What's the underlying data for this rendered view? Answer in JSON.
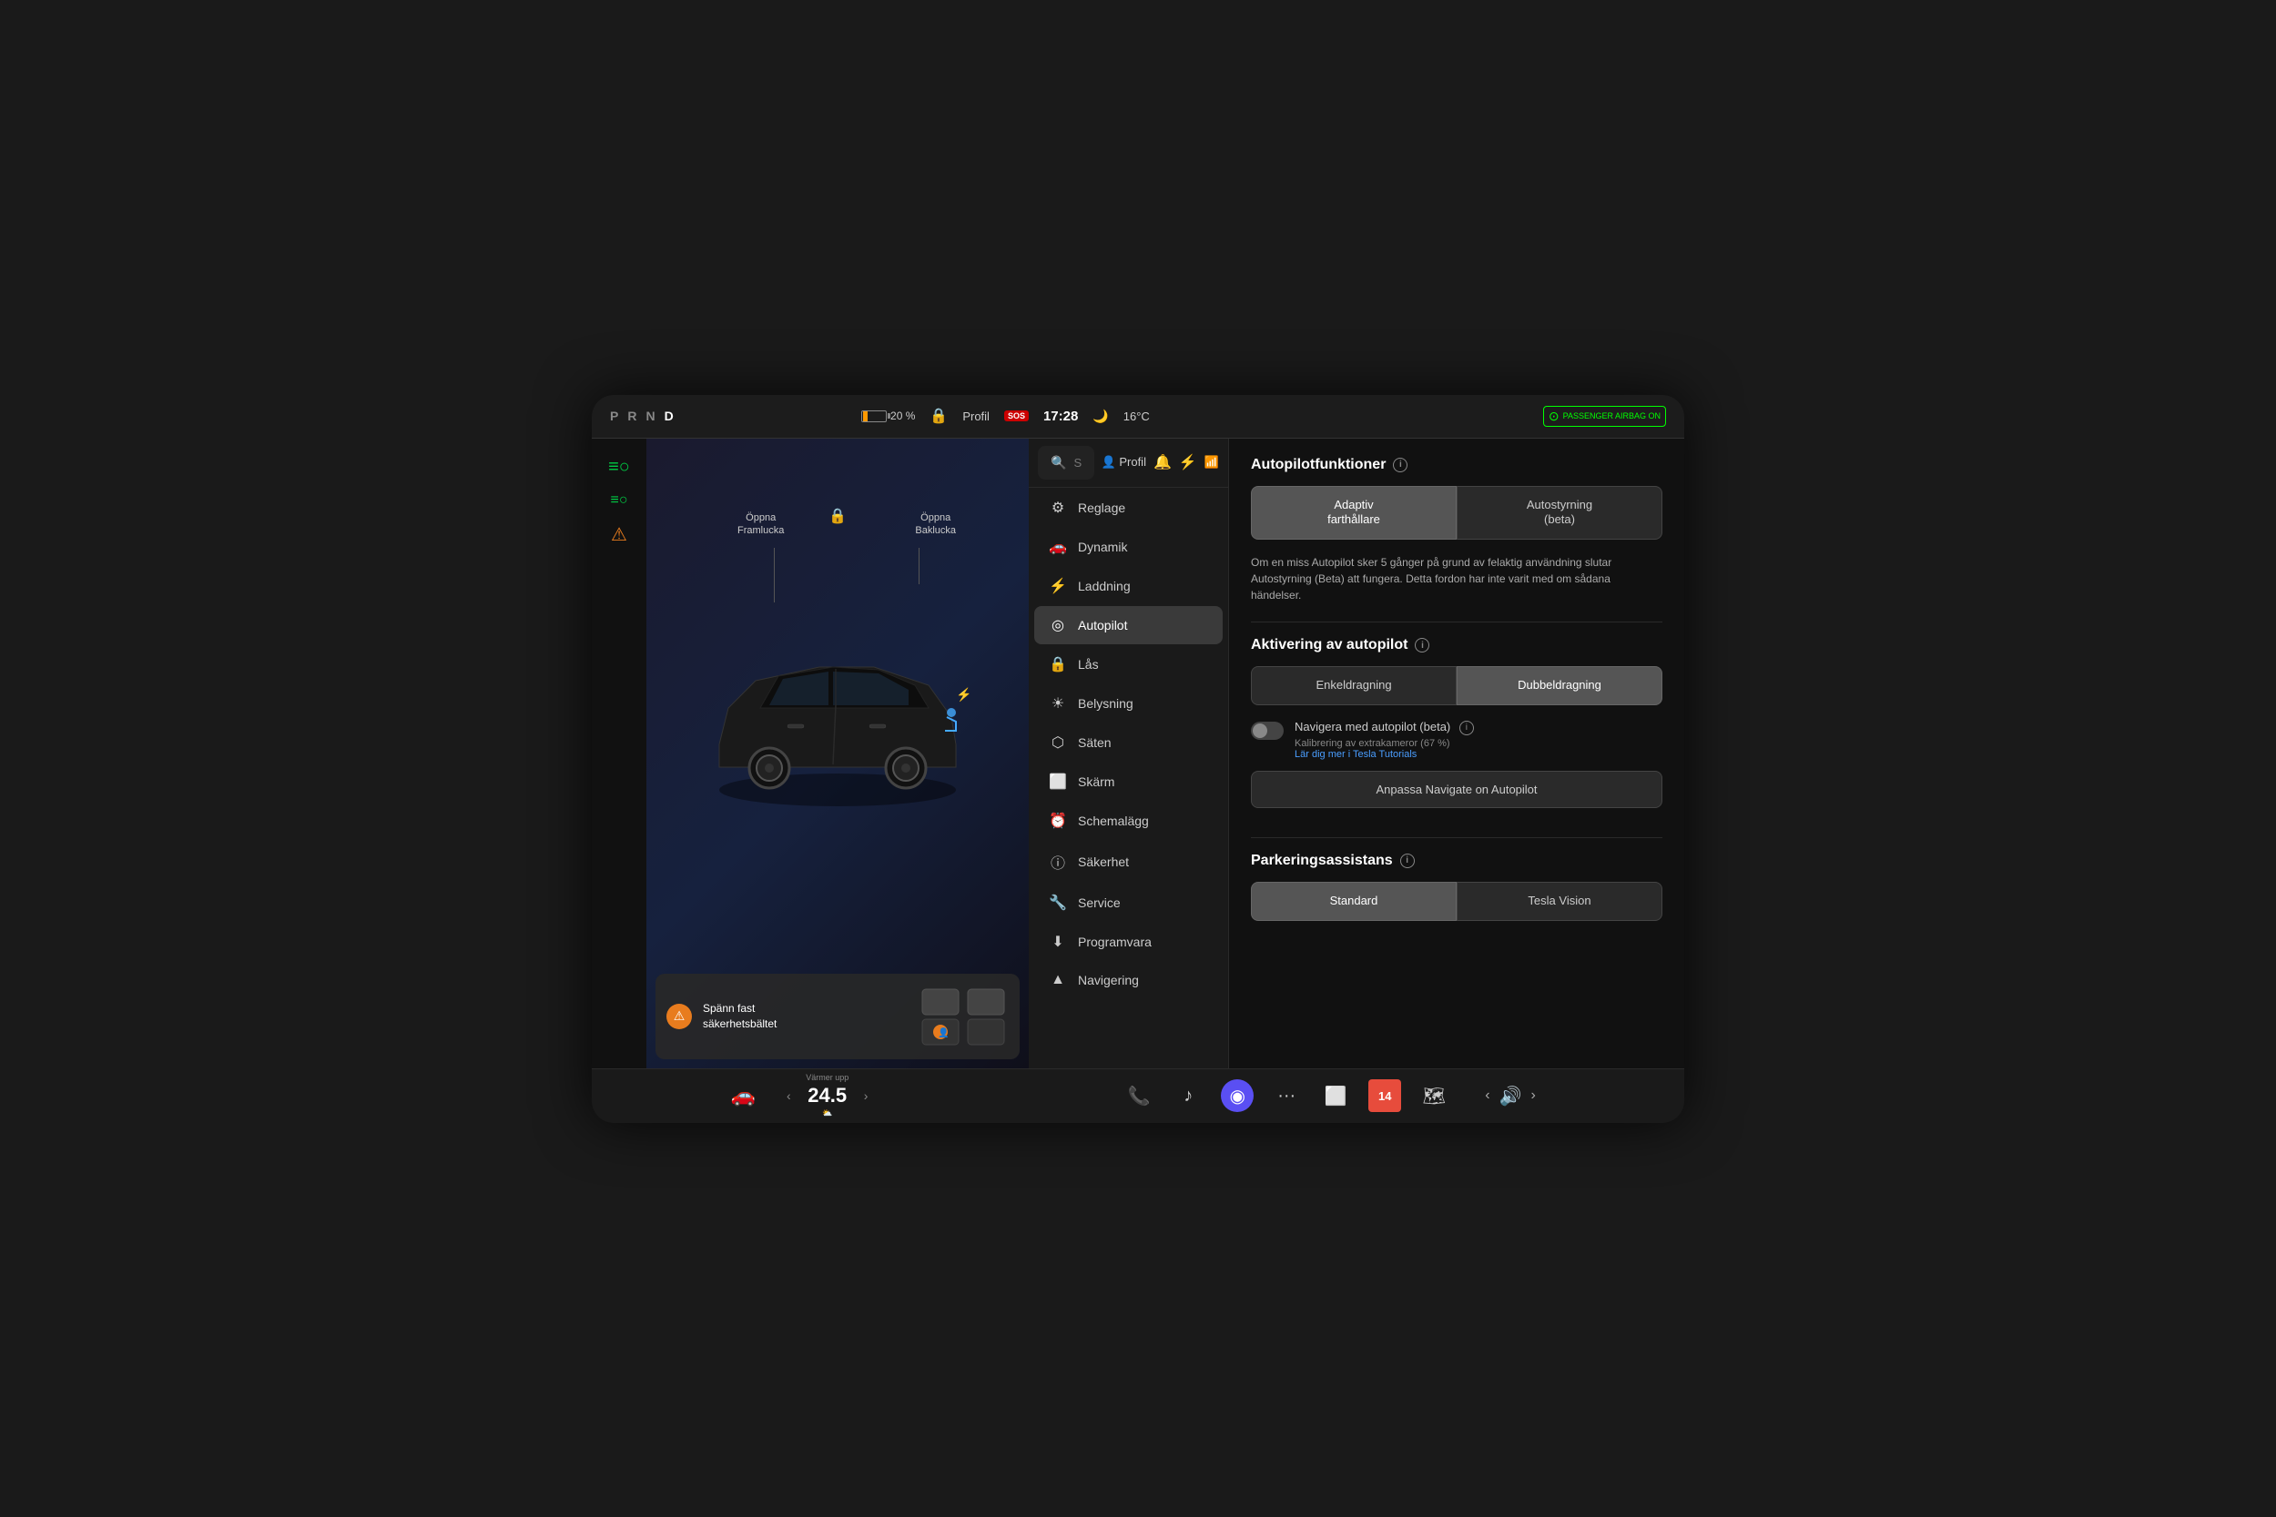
{
  "statusBar": {
    "prnd": [
      "P",
      "R",
      "N",
      "D"
    ],
    "active": "D",
    "battery": "20 %",
    "profile": "Profil",
    "sos": "SOS",
    "time": "17:28",
    "moon": "🌙",
    "temp": "16°C",
    "passengerAirbag": "PASSENGER AIRBAG ON"
  },
  "search": {
    "placeholder": "Sök",
    "profileLabel": "Profil"
  },
  "menu": {
    "items": [
      {
        "id": "reglage",
        "label": "Reglage",
        "icon": "⚙"
      },
      {
        "id": "dynamik",
        "label": "Dynamik",
        "icon": "🚗"
      },
      {
        "id": "laddning",
        "label": "Laddning",
        "icon": "⚡"
      },
      {
        "id": "autopilot",
        "label": "Autopilot",
        "icon": "◎",
        "active": true
      },
      {
        "id": "las",
        "label": "Lås",
        "icon": "🔒"
      },
      {
        "id": "belysning",
        "label": "Belysning",
        "icon": "☀"
      },
      {
        "id": "saten",
        "label": "Säten",
        "icon": "🪑"
      },
      {
        "id": "skarm",
        "label": "Skärm",
        "icon": "📺"
      },
      {
        "id": "schemalagg",
        "label": "Schemalägg",
        "icon": "⏰"
      },
      {
        "id": "sakerhet",
        "label": "Säkerhet",
        "icon": "ⓘ"
      },
      {
        "id": "service",
        "label": "Service",
        "icon": "🔧"
      },
      {
        "id": "programvara",
        "label": "Programvara",
        "icon": "⬇"
      },
      {
        "id": "navigering",
        "label": "Navigering",
        "icon": "▲"
      }
    ]
  },
  "autopilot": {
    "sectionTitle": "Autopilotfunktioner",
    "btn1": "Adaptiv\nfarthållare",
    "btn2": "Autostyrning\n(beta)",
    "desc": "Om en miss Autopilot sker 5 gånger på grund av felaktig användning slutar Autostyrning (Beta) att fungera. Detta fordon har inte varit med om sådana händelser.",
    "activationTitle": "Aktivering av autopilot",
    "singleDrag": "Enkeldragning",
    "doubleDrag": "Dubbeldragning",
    "navigateLabel": "Navigera med autopilot (beta)",
    "calibrationText": "Kalibrering av extrakameror (67 %)",
    "tutorialLink": "Lär dig mer i Tesla Tutorials",
    "customizeBtn": "Anpassa Navigate on Autopilot",
    "parkingTitle": "Parkeringsassistans",
    "parkingBtn1": "Standard",
    "parkingBtn2": "Tesla Vision"
  },
  "carLabels": {
    "framlucka": "Öppna\nFramlucka",
    "baklucka": "Öppna\nBaklucka"
  },
  "alert": {
    "text": "Spänn fast\nsäkerhetsbältet"
  },
  "taskbar": {
    "tempLabel": "Värmer upp",
    "tempValue": "24.5",
    "icons": [
      "📞",
      "♪",
      "◉",
      "···",
      "⬜",
      "14",
      "🗺"
    ]
  }
}
